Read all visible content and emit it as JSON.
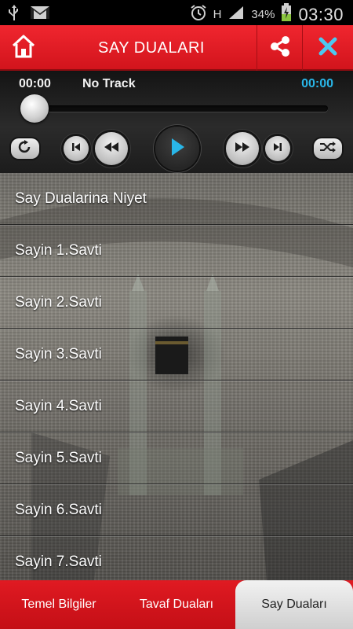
{
  "status_bar": {
    "battery_percent": "34%",
    "network": "H",
    "time": "03:30",
    "icons": [
      "usb-icon",
      "gmail-icon",
      "alarm-icon",
      "network-icon",
      "signal-icon",
      "battery-charging-icon"
    ]
  },
  "header": {
    "title": "SAY DUALARI",
    "home_icon": "home-icon",
    "share_icon": "share-icon",
    "close_icon": "close-icon",
    "accent_color": "#e21b23"
  },
  "player": {
    "elapsed": "00:00",
    "track": "No Track",
    "total": "00:00",
    "progress": 0,
    "controls": [
      "repeat-icon",
      "skip-previous-icon",
      "rewind-icon",
      "play-icon",
      "fast-forward-icon",
      "skip-next-icon",
      "shuffle-icon"
    ]
  },
  "list": {
    "items": [
      {
        "label": "Say Dualarina Niyet"
      },
      {
        "label": "Sayin 1.Savti"
      },
      {
        "label": "Sayin 2.Savti"
      },
      {
        "label": "Sayin 3.Savti"
      },
      {
        "label": "Sayin 4.Savti"
      },
      {
        "label": "Sayin 5.Savti"
      },
      {
        "label": "Sayin 6.Savti"
      },
      {
        "label": "Sayin 7.Savti"
      }
    ]
  },
  "tabs": {
    "items": [
      {
        "label": "Temel Bilgiler",
        "selected": false
      },
      {
        "label": "Tavaf Duaları",
        "selected": false
      },
      {
        "label": "Say Duaları",
        "selected": true
      }
    ]
  }
}
